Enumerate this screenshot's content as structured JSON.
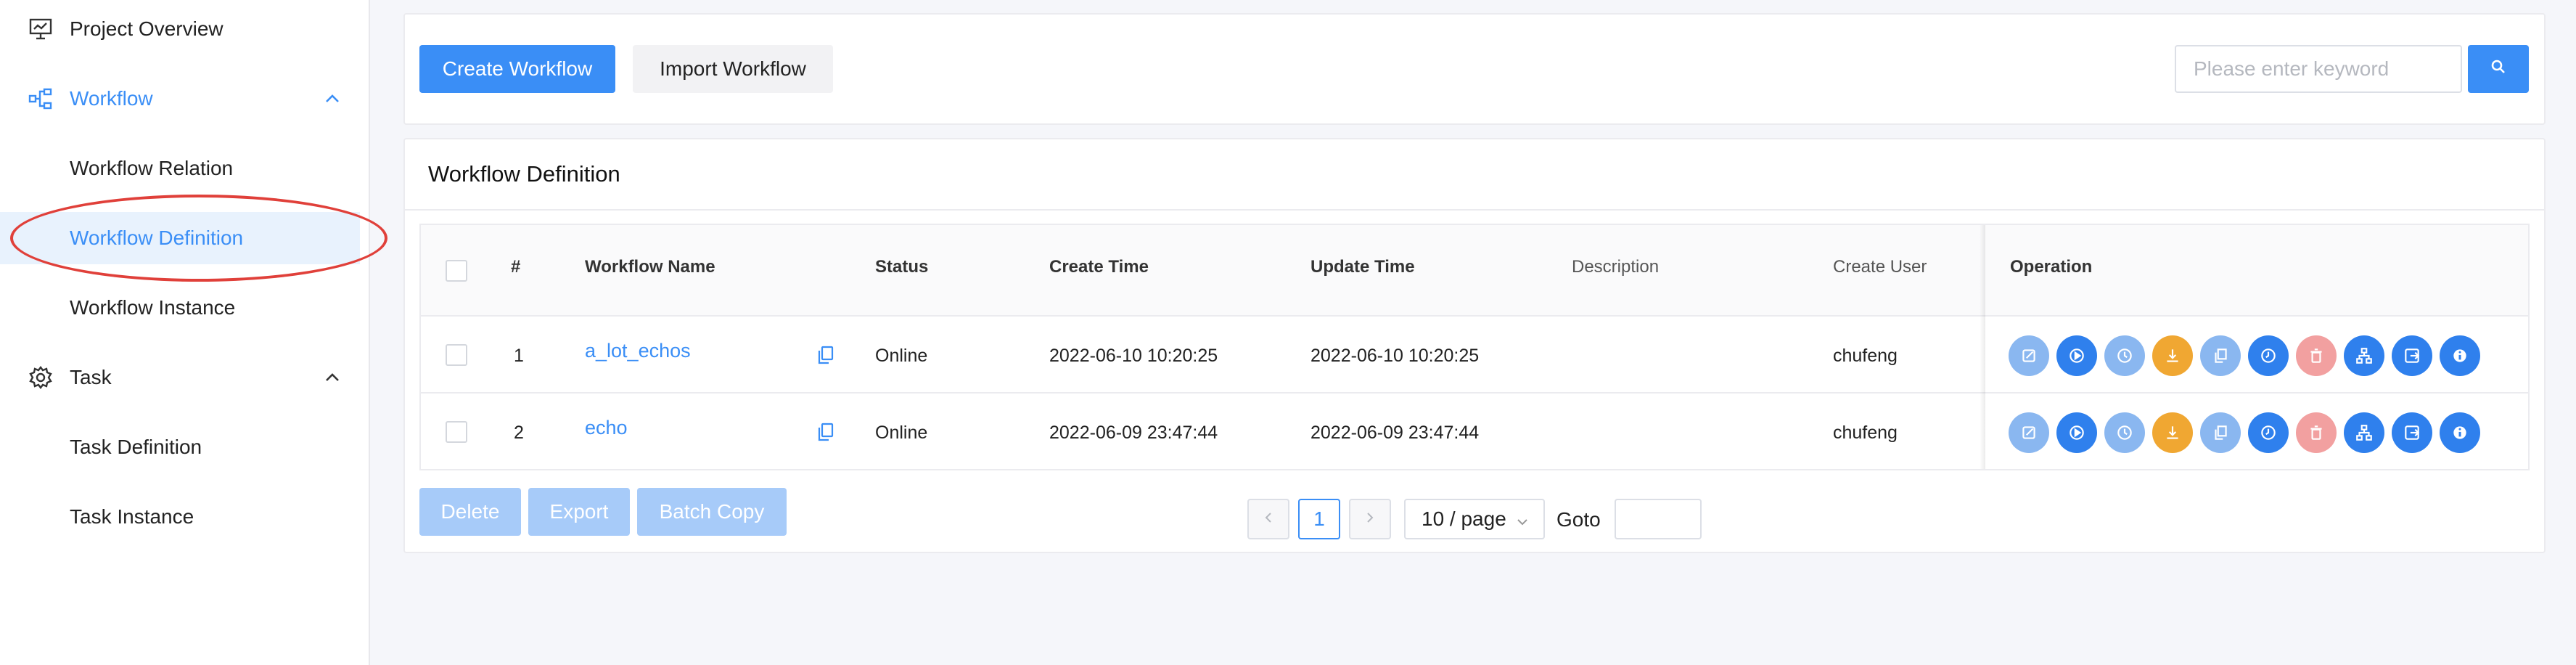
{
  "sidebar": {
    "items": [
      {
        "label": "Project Overview",
        "icon": "presentation-chart-icon"
      },
      {
        "label": "Workflow",
        "icon": "workflow-nodes-icon",
        "expanded": true
      },
      {
        "label": "Workflow Relation"
      },
      {
        "label": "Workflow Definition",
        "selected": true
      },
      {
        "label": "Workflow Instance"
      },
      {
        "label": "Task",
        "icon": "gear-icon",
        "expanded": true
      },
      {
        "label": "Task Definition"
      },
      {
        "label": "Task Instance"
      }
    ]
  },
  "toolbar": {
    "create_label": "Create Workflow",
    "import_label": "Import Workflow",
    "search_placeholder": "Please enter keyword",
    "search_value": ""
  },
  "section": {
    "title": "Workflow Definition"
  },
  "table": {
    "headers": [
      "#",
      "Workflow Name",
      "Status",
      "Create Time",
      "Update Time",
      "Description",
      "Create User",
      "Operation"
    ],
    "rows": [
      {
        "index": "1",
        "name": "a_lot_echos",
        "status": "Online",
        "create_time": "2022-06-10 10:20:25",
        "update_time": "2022-06-10 10:20:25",
        "description": "",
        "create_user": "chufeng"
      },
      {
        "index": "2",
        "name": "echo",
        "status": "Online",
        "create_time": "2022-06-09 23:47:44",
        "update_time": "2022-06-09 23:47:44",
        "description": "",
        "create_user": "chufeng"
      }
    ],
    "operations": [
      {
        "name": "edit-icon",
        "color": "#8ab7f0"
      },
      {
        "name": "run-icon",
        "color": "#2f80ed"
      },
      {
        "name": "timing-icon",
        "color": "#8ab7f0"
      },
      {
        "name": "download-icon",
        "color": "#f0a732"
      },
      {
        "name": "copy-icon",
        "color": "#8ab7f0"
      },
      {
        "name": "version-clock-icon",
        "color": "#2f80ed"
      },
      {
        "name": "delete-icon",
        "color": "#f2a0a0"
      },
      {
        "name": "tree-icon",
        "color": "#2f80ed"
      },
      {
        "name": "export-icon",
        "color": "#2f80ed"
      },
      {
        "name": "info-icon",
        "color": "#2f80ed"
      }
    ]
  },
  "batch": {
    "delete_label": "Delete",
    "export_label": "Export",
    "copy_label": "Batch Copy"
  },
  "pagination": {
    "current_page": "1",
    "page_size": "10 / page",
    "goto_label": "Goto",
    "goto_value": ""
  },
  "colors": {
    "accent": "#3a8ef6",
    "annotation": "#e0403a"
  }
}
